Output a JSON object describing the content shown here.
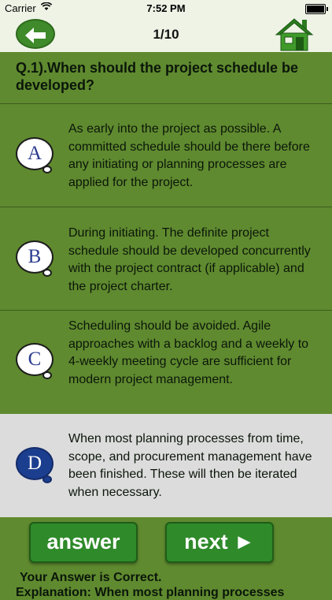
{
  "status_bar": {
    "carrier": "Carrier",
    "time": "7:52 PM"
  },
  "nav": {
    "counter": "1/10",
    "back_icon": "back-arrow-icon",
    "home_icon": "home-icon"
  },
  "question": {
    "text": "Q.1).When should the project schedule be developed?"
  },
  "options": [
    {
      "letter": "A",
      "text": "As early into the project as possible. A committed schedule should be there before any initiating or planning processes are applied for the project."
    },
    {
      "letter": "B",
      "text": "During initiating. The definite project schedule should be developed concurrently with the project contract (if applicable) and the project charter."
    },
    {
      "letter": "C",
      "text": "Scheduling should be avoided. Agile approaches with a backlog and a weekly to 4-weekly meeting cycle are sufficient for modern project management."
    },
    {
      "letter": "D",
      "text": "When most planning processes from time, scope, and procurement management have been finished. These will then be iterated when necessary.",
      "selected": true
    }
  ],
  "buttons": {
    "answer": "answer",
    "next": "next ►"
  },
  "result": {
    "status": "Your Answer is Correct.",
    "explanation_partial": "Explanation: When most planning processes"
  },
  "colors": {
    "background": "#5f8a2f",
    "header": "#eef3e6",
    "button": "#2f8a2a",
    "selected_row": "#dcdcdc",
    "selected_bubble": "#1c3e8e"
  }
}
